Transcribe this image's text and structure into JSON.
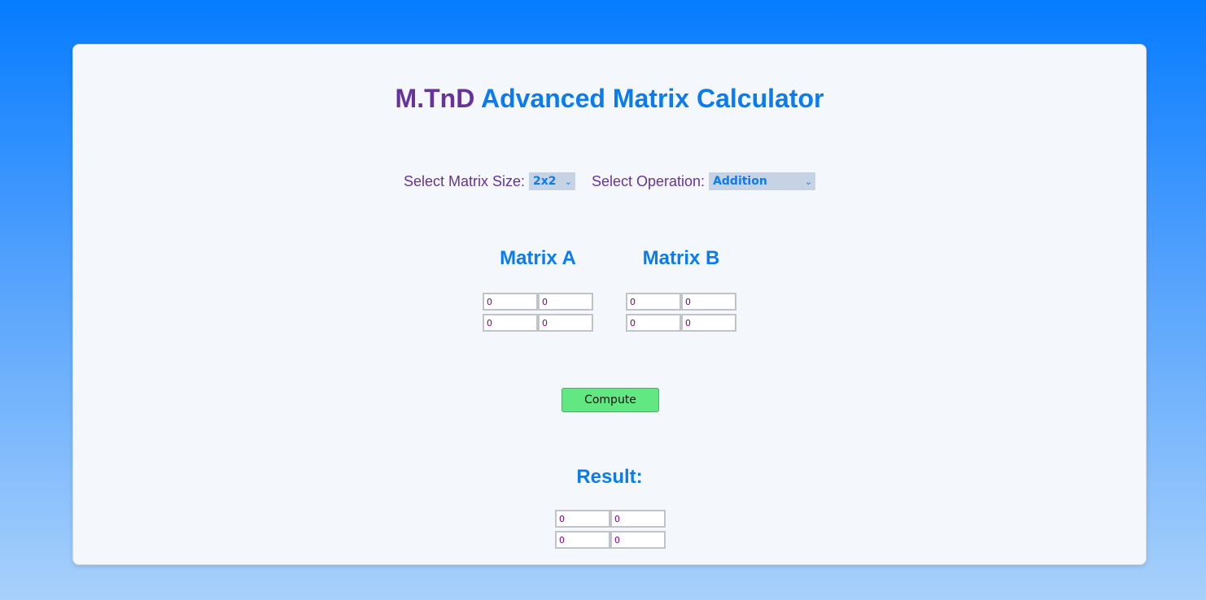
{
  "header": {
    "brand": "M.TnD",
    "title": "Advanced Matrix Calculator"
  },
  "controls": {
    "size_label": "Select Matrix Size:",
    "size_value": "2x2",
    "operation_label": "Select Operation:",
    "operation_value": "Addition"
  },
  "matrix_a": {
    "title": "Matrix A",
    "values": [
      [
        "0",
        "0"
      ],
      [
        "0",
        "0"
      ]
    ]
  },
  "matrix_b": {
    "title": "Matrix B",
    "values": [
      [
        "0",
        "0"
      ],
      [
        "0",
        "0"
      ]
    ]
  },
  "compute_label": "Compute",
  "result": {
    "title": "Result:",
    "values": [
      [
        "0",
        "0"
      ],
      [
        "0",
        "0"
      ]
    ]
  },
  "icons": {
    "dropdown": "chevron-down-icon"
  },
  "colors": {
    "brand": "#663399",
    "accent": "#0a7cf0",
    "button": "#62e882",
    "cell_text": "#800080"
  }
}
